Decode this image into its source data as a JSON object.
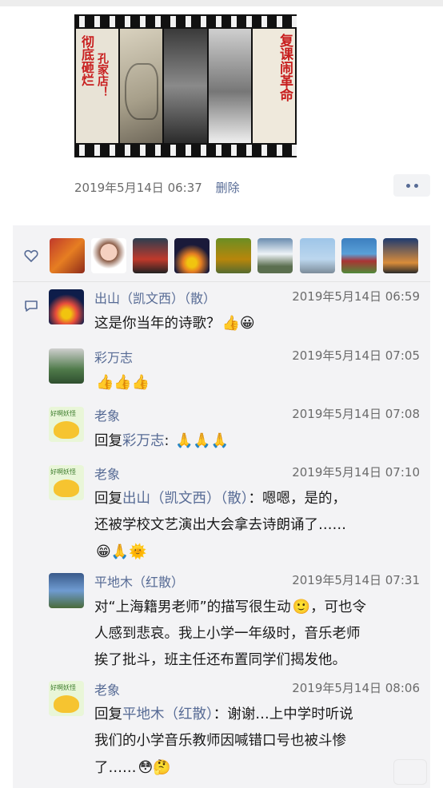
{
  "post": {
    "image_texts": {
      "left_red": "彻底砸烂",
      "left_sub": "孔家店！",
      "right_red": "复课闹革命"
    },
    "timestamp": "2019年5月14日 06:37",
    "delete_label": "删除"
  },
  "likes": {
    "icon": "heart-icon",
    "avatars": [
      "avatar-1",
      "avatar-2",
      "avatar-3",
      "avatar-4",
      "avatar-5",
      "avatar-6",
      "avatar-7",
      "avatar-8",
      "avatar-9"
    ]
  },
  "comments": [
    {
      "author": "出山（凯文西）（散）",
      "time": "2019年5月14日 06:59",
      "text": "这是你当年的诗歌？",
      "emojis": "👍😀"
    },
    {
      "author": "彩万志",
      "time": "2019年5月14日 07:05",
      "text": "",
      "emojis": "👍👍👍"
    },
    {
      "author": "老象",
      "time": "2019年5月14日 07:08",
      "reply_prefix": "回复",
      "reply_to": "彩万志",
      "text": ": ",
      "emojis": "🙏🙏🙏",
      "avatar_caption": "好啊妖怪"
    },
    {
      "author": "老象",
      "time": "2019年5月14日 07:10",
      "reply_prefix": "回复",
      "reply_to": "出山（凯文西）（散）",
      "text_line1": "：嗯嗯，是的，",
      "text_line2": "还被学校文艺演出大会拿去诗朗诵了……",
      "emojis": "😁🙏🌞",
      "avatar_caption": "好啊妖怪"
    },
    {
      "author": "平地木（红散）",
      "time": "2019年5月14日 07:31",
      "text_line1": "对“上海籍男老师”的描写很生动",
      "emoji_inline": "🙂",
      "text_line1b": "，可也令",
      "text_line2": "人感到悲哀。我上小学一年级时，音乐老师",
      "text_line3": "挨了批斗，班主任还布置同学们揭发他。"
    },
    {
      "author": "老象",
      "time": "2019年5月14日 08:06",
      "reply_prefix": "回复",
      "reply_to": "平地木（红散）",
      "text_line1": "：谢谢…上中学时听说",
      "text_line2": "我们的小学音乐教师因喊错口号也被斗惨",
      "text_line3": "了……",
      "emojis": "😳🤔",
      "avatar_caption": "好啊妖怪"
    }
  ]
}
